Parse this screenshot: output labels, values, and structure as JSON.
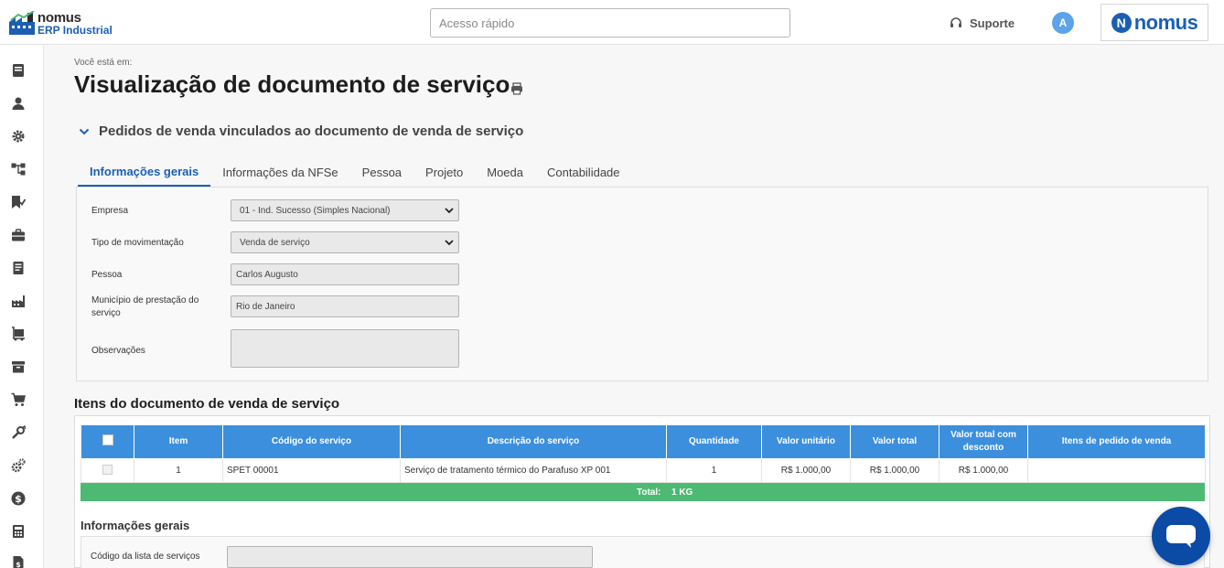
{
  "header": {
    "logo_line1": "nomus",
    "logo_line2": "ERP Industrial",
    "search_placeholder": "Acesso rápido",
    "support_label": "Suporte",
    "user_initial": "A",
    "brand_word": "nomus",
    "brand_letter": "N"
  },
  "sidebar": {
    "icons": [
      "book-icon",
      "person-icon",
      "gear-icon",
      "flow-icon",
      "checklist-icon",
      "briefcase-icon",
      "document-icon",
      "factory-icon",
      "shipping-icon",
      "archive-icon",
      "cart-icon",
      "tools-icon",
      "cogs-icon",
      "dollar-icon",
      "calculator-icon",
      "invoice-icon"
    ]
  },
  "page": {
    "breadcrumb": "Você está em:",
    "title": "Visualização de documento de serviço",
    "linked_section": "Pedidos de venda vinculados ao documento de venda de serviço"
  },
  "tabs": [
    {
      "label": "Informações gerais",
      "active": true
    },
    {
      "label": "Informações da NFSe",
      "active": false
    },
    {
      "label": "Pessoa",
      "active": false
    },
    {
      "label": "Projeto",
      "active": false
    },
    {
      "label": "Moeda",
      "active": false
    },
    {
      "label": "Contabilidade",
      "active": false
    }
  ],
  "form": {
    "empresa_label": "Empresa",
    "empresa_value": "01 - Ind. Sucesso (Simples Nacional)",
    "tipo_label": "Tipo de movimentação",
    "tipo_value": "Venda de serviço",
    "pessoa_label": "Pessoa",
    "pessoa_value": "Carlos Augusto",
    "municipio_label": "Município de prestação do serviço",
    "municipio_value": "Rio de Janeiro",
    "observacoes_label": "Observações",
    "observacoes_value": ""
  },
  "items": {
    "title": "Itens do documento de venda de serviço",
    "columns": [
      "Item",
      "Código do serviço",
      "Descrição do serviço",
      "Quantidade",
      "Valor unitário",
      "Valor total",
      "Valor total com desconto",
      "Itens de pedido de venda"
    ],
    "rows": [
      {
        "item": "1",
        "codigo": "SPET 00001",
        "descricao": "Serviço de tratamento térmico do Parafuso XP 001",
        "quantidade": "1",
        "valor_unitario": "R$ 1.000,00",
        "valor_total": "R$ 1.000,00",
        "valor_desconto": "R$ 1.000,00",
        "itens_pedido": ""
      }
    ],
    "total_label": "Total:",
    "total_value": "1 KG"
  },
  "info_gerais": {
    "title": "Informações gerais",
    "codigo_lista_label": "Código da lista de serviços",
    "codigo_lista_value": ""
  },
  "colors": {
    "accent": "#1b5fb3",
    "table_header": "#3c8fdc",
    "total_bar": "#4cba73",
    "chat_button": "#0b4ba5"
  }
}
